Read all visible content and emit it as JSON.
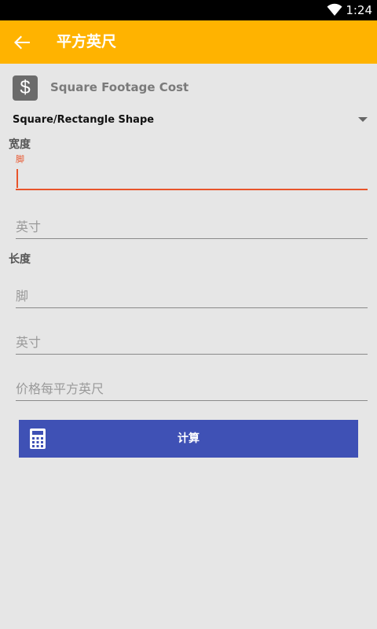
{
  "status_bar": {
    "time": "1:24",
    "wifi_icon": "wifi-icon"
  },
  "app_bar": {
    "title": "平方英尺",
    "back_icon": "arrow-back-icon",
    "color": "#ffb300"
  },
  "header": {
    "icon": "dollar-icon",
    "label": "Square Footage Cost"
  },
  "shape_spinner": {
    "selected": "Square/Rectangle Shape"
  },
  "width_section": {
    "label": "宽度",
    "feet_field": {
      "floating_label": "脚",
      "value": "",
      "placeholder": ""
    },
    "inches_field": {
      "value": "",
      "placeholder": "英寸"
    }
  },
  "length_section": {
    "label": "长度",
    "feet_field": {
      "value": "",
      "placeholder": "脚"
    },
    "inches_field": {
      "value": "",
      "placeholder": "英寸"
    }
  },
  "price_field": {
    "value": "",
    "placeholder": "价格每平方英尺"
  },
  "calculate_button": {
    "label": "计算",
    "icon": "calculator-icon",
    "color": "#3f51b5"
  },
  "accent_color": "#e8542b"
}
